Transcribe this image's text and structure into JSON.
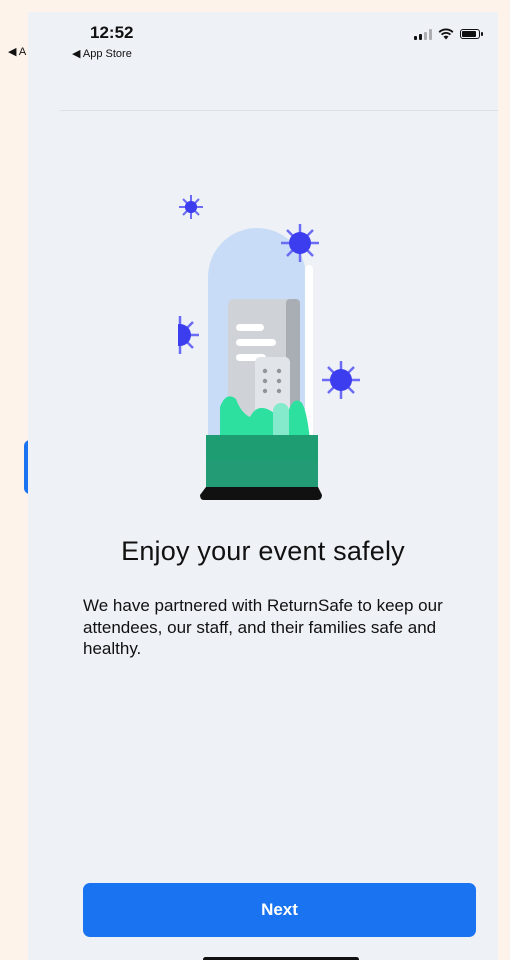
{
  "status_bar": {
    "time": "12:52",
    "back_label": "◀ App Store",
    "peek_back_label": "◀ A"
  },
  "onboarding": {
    "title": "Enjoy your event safely",
    "description": "We have partnered with ReturnSafe to keep our attendees, our staff, and their families safe and healthy.",
    "next_label": "Next"
  },
  "colors": {
    "accent": "#1a73f0",
    "virus": "#3d3df0",
    "green": "#2ee0a0",
    "page_bg": "#eef1f6"
  }
}
